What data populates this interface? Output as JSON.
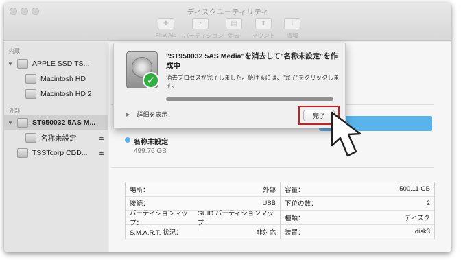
{
  "window": {
    "title": "ディスクユーティリティ"
  },
  "toolbar": {
    "items": [
      {
        "label": "First Aid",
        "icon": "first-aid-icon"
      },
      {
        "label": "パーティション",
        "icon": "partition-icon"
      },
      {
        "label": "消去",
        "icon": "erase-icon"
      },
      {
        "label": "マウント",
        "icon": "mount-icon"
      },
      {
        "label": "情報",
        "icon": "info-icon"
      }
    ]
  },
  "sidebar": {
    "internal_header": "内蔵",
    "external_header": "外部",
    "items": [
      {
        "label": "APPLE SSD TS...",
        "icon": "internal-disk-icon"
      },
      {
        "label": "Macintosh HD",
        "icon": "volume-icon"
      },
      {
        "label": "Macintosh HD 2",
        "icon": "volume-icon"
      },
      {
        "label": "ST950032 5AS M...",
        "icon": "external-disk-icon",
        "selected": true
      },
      {
        "label": "名称未設定",
        "icon": "volume-icon",
        "eject": "⏏"
      },
      {
        "label": "TSSTcorp CDD...",
        "icon": "optical-drive-icon",
        "eject": "⏏"
      }
    ]
  },
  "main": {
    "volume_name": "名称未設定",
    "volume_size": "499.76 GB",
    "usage_color": "#5ab4ec",
    "info_rows": [
      {
        "left_label": "場所：",
        "left_value": "外部",
        "right_label": "容量：",
        "right_value": "500.11 GB"
      },
      {
        "left_label": "接続：",
        "left_value": "USB",
        "right_label": "下位の数：",
        "right_value": "2"
      },
      {
        "left_label": "パーティションマップ：",
        "left_value": "GUID パーティションマップ",
        "right_label": "種類：",
        "right_value": "ディスク"
      },
      {
        "left_label": "S.M.A.R.T. 状況：",
        "left_value": "非対応",
        "right_label": "装置：",
        "right_value": "disk3"
      }
    ]
  },
  "dialog": {
    "title": "\"ST950032 5AS Media\"を消去して\"名称未設定\"を作成中",
    "message": "消去プロセスが完了しました。続けるには、\"完了\"をクリックします。",
    "progress_fraction": 1.0,
    "details_label": "詳細を表示",
    "done_label": "完了",
    "highlight_color": "#d41a1a"
  }
}
